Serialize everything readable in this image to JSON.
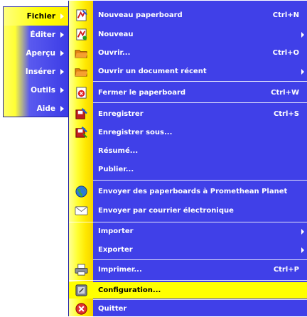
{
  "main_menu": {
    "items": [
      {
        "label": "Fichier",
        "active": true,
        "has_submenu": true
      },
      {
        "label": "Éditer",
        "has_submenu": true
      },
      {
        "label": "Aperçu",
        "has_submenu": true
      },
      {
        "label": "Insérer",
        "has_submenu": true
      },
      {
        "label": "Outils",
        "has_submenu": true
      },
      {
        "label": "Aide",
        "has_submenu": true
      }
    ]
  },
  "file_menu": {
    "items": [
      {
        "label": "Nouveau paperboard",
        "shortcut": "Ctrl+N",
        "icon": "new-flipchart-icon"
      },
      {
        "label": "Nouveau",
        "shortcut": "",
        "icon": "new-icon",
        "has_submenu": true
      },
      {
        "label": "Ouvrir...",
        "shortcut": "Ctrl+O",
        "icon": "open-folder-icon"
      },
      {
        "label": "Ouvrir un document récent",
        "shortcut": "",
        "icon": "recent-folder-icon",
        "has_submenu": true
      },
      {
        "label": "Fermer le paperboard",
        "shortcut": "Ctrl+W",
        "icon": "close-flipchart-icon"
      },
      {
        "label": "Enregistrer",
        "shortcut": "Ctrl+S",
        "icon": "save-icon"
      },
      {
        "label": "Enregistrer sous...",
        "shortcut": "",
        "icon": "save-as-icon"
      },
      {
        "label": "Résumé...",
        "shortcut": "",
        "icon": ""
      },
      {
        "label": "Publier...",
        "shortcut": "",
        "icon": ""
      },
      {
        "label": "Envoyer des paperboards à Promethean Planet",
        "shortcut": "",
        "icon": "globe-icon"
      },
      {
        "label": "Envoyer par courrier électronique",
        "shortcut": "",
        "icon": "envelope-icon"
      },
      {
        "label": "Importer",
        "shortcut": "",
        "icon": "",
        "has_submenu": true
      },
      {
        "label": "Exporter",
        "shortcut": "",
        "icon": "",
        "has_submenu": true
      },
      {
        "label": "Imprimer...",
        "shortcut": "Ctrl+P",
        "icon": "printer-icon"
      },
      {
        "label": "Configuration...",
        "shortcut": "",
        "icon": "settings-icon",
        "highlighted": true
      },
      {
        "label": "Quitter",
        "shortcut": "",
        "icon": "exit-icon"
      }
    ]
  },
  "colors": {
    "menu_blue": "#4040e8",
    "highlight_yellow": "#ffff00",
    "strip_yellow": "#ffe800"
  }
}
